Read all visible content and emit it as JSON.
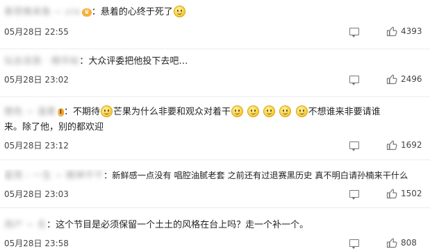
{
  "comments": [
    {
      "username": "泰悲晚来鱼 ~ cro",
      "badge": "crown",
      "text_line1": "：悬着的心终于死了",
      "text_line1_tail_emoji": 1,
      "timestamp": "05月28日 22:55",
      "likes": "4393"
    },
    {
      "username": "坛总说我 · 精华帖",
      "text_line1": "：大众评委把他投下去吧…",
      "timestamp": "05月28日 23:02",
      "likes": "2496"
    },
    {
      "username": "橙色 ~ 温柔",
      "badge": "vip",
      "badge_label": "I",
      "text_seg_a": "：不期待",
      "text_seg_b": "芒果为什么非要和观众对着干",
      "text_seg_c": "不想谁来非要请谁",
      "text_line2": "来。除了他，别的都欢迎",
      "timestamp": "05月28日 23:12",
      "likes": "1692"
    },
    {
      "username": "星雨 - 一生 ~ 眼神不干",
      "text_line1": "：新鲜感一点没有 唱腔油腻老套 之前还有过退赛黑历史 真不明白请孙楠来干什么",
      "timestamp": "05月28日 23:03",
      "likes": "1502"
    },
    {
      "username": "用户 ~ 名",
      "text_line1": "：这个节目是必须保留一个土土的风格在台上吗？走一个补一个。",
      "timestamp": "05月28日 23:58",
      "likes": "808"
    }
  ],
  "icons": {
    "reply": "comment-icon",
    "like": "thumbs-up-icon",
    "emoji": "smile-emoji-icon"
  },
  "colors": {
    "text": "#222222",
    "meta": "#444444",
    "username_blurred": "#9c9c9c",
    "emoji": "#f8d44a"
  }
}
